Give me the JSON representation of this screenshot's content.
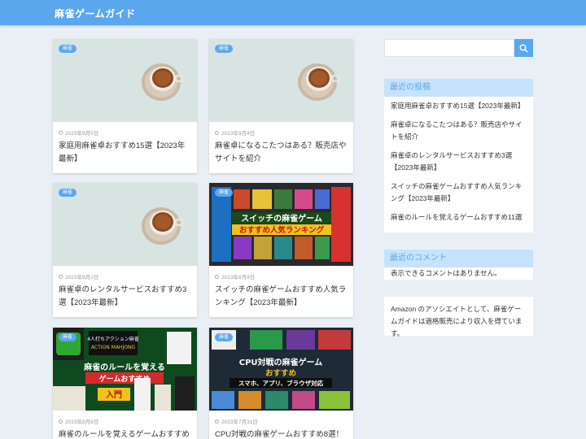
{
  "header": {
    "title": "麻雀ゲームガイド",
    "bg": "#5aa7ee"
  },
  "posts": [
    {
      "category": "麻雀",
      "date": "2023年9月5日",
      "title": "家庭用麻雀卓おすすめ15選【2023年最新】"
    },
    {
      "category": "麻雀",
      "date": "2023年9月4日",
      "title": "麻雀卓になるこたつはある？販売店やサイトを紹介"
    },
    {
      "category": "麻雀",
      "date": "2023年9月2日",
      "title": "麻雀卓のレンタルサービスおすすめ3選【2023年最新】"
    },
    {
      "category": "麻雀",
      "date": "2023年8月9日",
      "title": "スイッチの麻雀ゲームおすすめ人気ランキング【2023年最新】"
    },
    {
      "category": "麻雀",
      "date": "2023年8月8日",
      "title": "麻雀のルールを覚えるゲームおすすめ11"
    },
    {
      "category": "麻雀",
      "date": "2023年7月31日",
      "title": "CPU対戦の麻雀ゲームおすすめ8選！ス"
    }
  ],
  "thumb_text": {
    "switch_line1": "スイッチの麻雀ゲーム",
    "switch_line2": "おすすめ人気ランキング",
    "rules_line1": "麻雀のルールを覚える",
    "rules_line2": "ゲームおすすめ",
    "rules_badge": "入門",
    "rules_box": "4人打ちアクション麻雀",
    "rules_box2": "ACTION MAHJONG",
    "cpu_line1": "CPU対戦の麻雀ゲーム",
    "cpu_line2": "おすすめ",
    "cpu_line3": "スマホ、アプリ、ブラウザ対応"
  },
  "sidebar": {
    "search": {
      "placeholder": ""
    },
    "recent_posts": {
      "title": "最近の投稿",
      "items": [
        "家庭用麻雀卓おすすめ15選【2023年最新】",
        "麻雀卓になるこたつはある？販売店やサイトを紹介",
        "麻雀卓のレンタルサービスおすすめ3選【2023年最新】",
        "スイッチの麻雀ゲームおすすめ人気ランキング【2023年最新】",
        "麻雀のルールを覚えるゲームおすすめ11選"
      ]
    },
    "recent_comments": {
      "title": "最近のコメント",
      "text": "表示できるコメントはありません。"
    },
    "amazon": {
      "text": "Amazon のアソシエイトとして、麻雀ゲームガイドは適格販売により収入を得ています。"
    }
  },
  "colors": {
    "accent": "#5aa7ee",
    "widget_title_bg": "#c6e3fd",
    "page_bg": "#e9eff5"
  }
}
